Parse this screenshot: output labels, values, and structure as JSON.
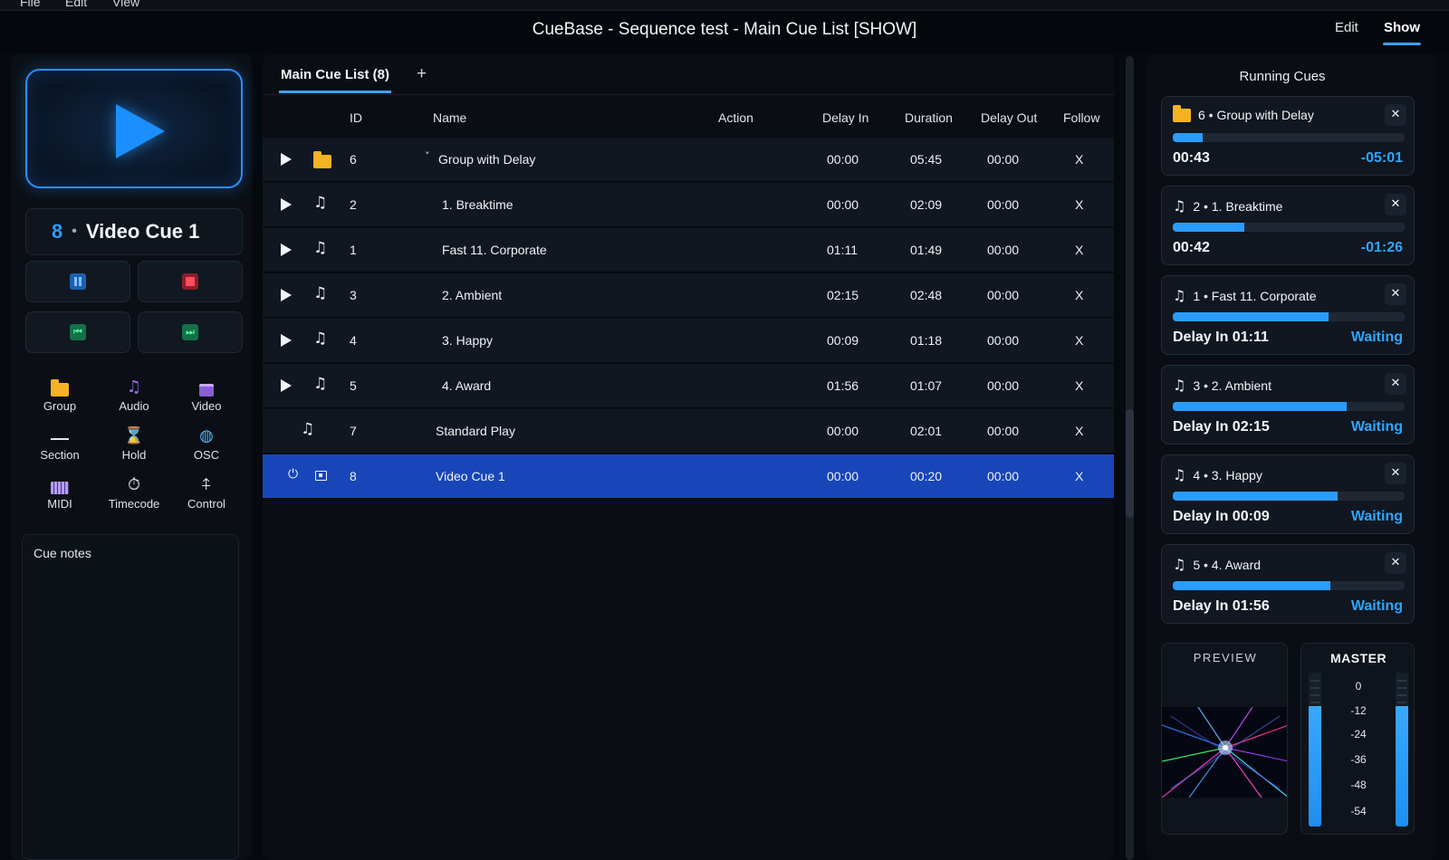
{
  "menubar": {
    "items": [
      "File",
      "Edit",
      "View"
    ]
  },
  "window": {
    "title": "CueBase - Sequence test - Main Cue List [SHOW]"
  },
  "modes": {
    "edit": "Edit",
    "show": "Show",
    "active": "Show"
  },
  "go_panel": {
    "current_cue_number": "8",
    "current_cue_separator": "•",
    "current_cue_name": "Video Cue 1"
  },
  "tools": [
    {
      "label": "Group",
      "icon": "folder-icon"
    },
    {
      "label": "Audio",
      "icon": "music-note-icon"
    },
    {
      "label": "Video",
      "icon": "video-icon"
    },
    {
      "label": "Section",
      "icon": "section-line-icon"
    },
    {
      "label": "Hold",
      "icon": "hourglass-icon"
    },
    {
      "label": "OSC",
      "icon": "globe-icon"
    },
    {
      "label": "MIDI",
      "icon": "midi-keyboard-icon"
    },
    {
      "label": "Timecode",
      "icon": "stopwatch-icon"
    },
    {
      "label": "Control",
      "icon": "control-icon"
    }
  ],
  "notes": {
    "title": "Cue notes"
  },
  "cue_list": {
    "tab_label": "Main Cue List (8)",
    "add_tab": "+",
    "columns": {
      "id": "ID",
      "name": "Name",
      "action": "Action",
      "delay_in": "Delay In",
      "duration": "Duration",
      "delay_out": "Delay Out",
      "follow": "Follow"
    },
    "rows": [
      {
        "id": "6",
        "name": "Group with Delay",
        "type": "group",
        "delay_in": "00:00",
        "duration": "05:45",
        "delay_out": "00:00",
        "follow": "X",
        "expand": "˅",
        "selected": false
      },
      {
        "id": "2",
        "name": "1. Breaktime",
        "type": "audio",
        "delay_in": "00:00",
        "duration": "02:09",
        "delay_out": "00:00",
        "follow": "X",
        "selected": false
      },
      {
        "id": "1",
        "name": "Fast 11. Corporate",
        "type": "audio",
        "delay_in": "01:11",
        "duration": "01:49",
        "delay_out": "00:00",
        "follow": "X",
        "selected": false
      },
      {
        "id": "3",
        "name": "2. Ambient",
        "type": "audio",
        "delay_in": "02:15",
        "duration": "02:48",
        "delay_out": "00:00",
        "follow": "X",
        "selected": false
      },
      {
        "id": "4",
        "name": "3. Happy",
        "type": "audio",
        "delay_in": "00:09",
        "duration": "01:18",
        "delay_out": "00:00",
        "follow": "X",
        "selected": false
      },
      {
        "id": "5",
        "name": "4. Award",
        "type": "audio",
        "delay_in": "01:56",
        "duration": "01:07",
        "delay_out": "00:00",
        "follow": "X",
        "selected": false
      },
      {
        "id": "7",
        "name": "Standard Play",
        "type": "audio",
        "delay_in": "00:00",
        "duration": "02:01",
        "delay_out": "00:00",
        "follow": "X",
        "selected": false
      },
      {
        "id": "8",
        "name": "Video Cue 1",
        "type": "video",
        "delay_in": "00:00",
        "duration": "00:20",
        "delay_out": "00:00",
        "follow": "X",
        "selected": true
      }
    ]
  },
  "running": {
    "title": "Running Cues",
    "close": "✕",
    "cards": [
      {
        "title": "6 • Group with Delay",
        "icon": "folder-icon",
        "progress": 0.13,
        "left": "00:43",
        "right": "-05:01"
      },
      {
        "title": "2 • 1. Breaktime",
        "icon": "music-note-icon",
        "progress": 0.31,
        "left": "00:42",
        "right": "-01:26"
      },
      {
        "title": "1 • Fast 11. Corporate",
        "icon": "music-note-icon",
        "progress": 0.67,
        "left": "Delay In 01:11",
        "right": "Waiting"
      },
      {
        "title": "3 • 2. Ambient",
        "icon": "music-note-icon",
        "progress": 0.75,
        "left": "Delay In 02:15",
        "right": "Waiting"
      },
      {
        "title": "4 • 3. Happy",
        "icon": "music-note-icon",
        "progress": 0.71,
        "left": "Delay In 00:09",
        "right": "Waiting"
      },
      {
        "title": "5 • 4. Award",
        "icon": "music-note-icon",
        "progress": 0.68,
        "left": "Delay In 01:56",
        "right": "Waiting"
      }
    ]
  },
  "preview": {
    "title": "PREVIEW"
  },
  "master": {
    "title": "MASTER",
    "scale": [
      "0",
      "-12",
      "-24",
      "-36",
      "-48",
      "-54"
    ],
    "level_left": 0.78,
    "level_right": 0.78
  },
  "colors": {
    "accent": "#2a9cff",
    "selected_row": "#1846b8",
    "folder": "#f5b324"
  }
}
